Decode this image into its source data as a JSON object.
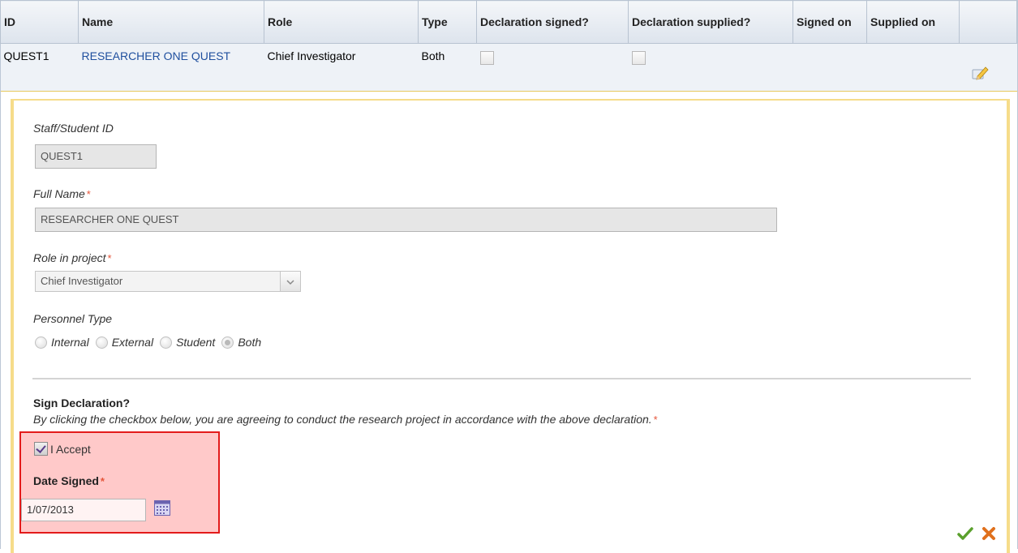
{
  "table": {
    "headers": [
      "ID",
      "Name",
      "Role",
      "Type",
      "Declaration signed?",
      "Declaration supplied?",
      "Signed on",
      "Supplied on",
      ""
    ],
    "row": {
      "id": "QUEST1",
      "name": "RESEARCHER ONE QUEST",
      "role": "Chief Investigator",
      "type": "Both",
      "declaration_signed": false,
      "declaration_supplied": false,
      "signed_on": "",
      "supplied_on": ""
    }
  },
  "form": {
    "staff_id_label": "Staff/Student ID",
    "staff_id_value": "QUEST1",
    "full_name_label": "Full Name",
    "full_name_value": "RESEARCHER ONE QUEST",
    "role_label": "Role in project",
    "role_value": "Chief Investigator",
    "personnel_type_label": "Personnel Type",
    "personnel_types": [
      "Internal",
      "External",
      "Student",
      "Both"
    ],
    "personnel_type_selected": "Both",
    "required_marker": "*",
    "sign_title": "Sign Declaration?",
    "sign_text": "By clicking the checkbox below, you are agreeing to conduct the research project in accordance with the above declaration.",
    "accept_label": "I Accept",
    "accept_checked": true,
    "date_label": "Date Signed",
    "date_value": "1/07/2013"
  },
  "icons": {
    "edit": "pencil-edit-icon",
    "calendar": "calendar-icon",
    "save": "green-check-icon",
    "cancel": "orange-x-icon"
  },
  "colors": {
    "link": "#1f4f9e",
    "highlight_fill": "#ffc9c9",
    "highlight_border": "#e31b1b",
    "panel_border": "#f6dc8a",
    "required": "#e5553a"
  }
}
